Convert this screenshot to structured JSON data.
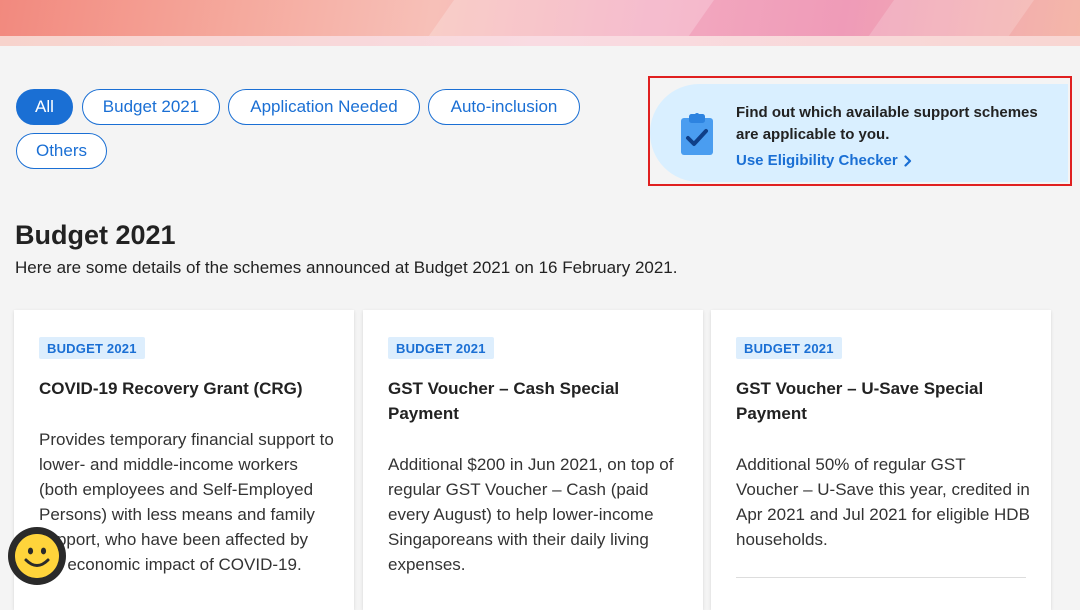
{
  "filters": [
    {
      "label": "All",
      "active": true
    },
    {
      "label": "Budget 2021",
      "active": false
    },
    {
      "label": "Application Needed",
      "active": false
    },
    {
      "label": "Auto-inclusion",
      "active": false
    },
    {
      "label": "Others",
      "active": false
    }
  ],
  "promo": {
    "text": "Find out which available support schemes are applicable to you.",
    "link_label": "Use Eligibility Checker",
    "icon": "clipboard-check-icon"
  },
  "section": {
    "title": "Budget 2021",
    "description": "Here are some details of the schemes announced at Budget 2021 on 16 February 2021."
  },
  "cards": [
    {
      "badge": "BUDGET 2021",
      "title": "COVID-19 Recovery Grant (CRG)",
      "body": "Provides temporary financial support to lower- and middle-income workers (both employees and Self-Employed Persons) with less means and family support, who have been affected by the economic impact of COVID-19."
    },
    {
      "badge": "BUDGET 2021",
      "title": "GST Voucher – Cash Special Payment",
      "body": "Additional $200 in Jun 2021, on top of regular GST Voucher – Cash (paid every August) to help lower-income Singaporeans with their daily living expenses."
    },
    {
      "badge": "BUDGET 2021",
      "title": "GST Voucher – U-Save Special Payment",
      "body": "Additional 50% of regular GST Voucher – U-Save this year, credited in Apr 2021 and Jul 2021 for eligible HDB households."
    }
  ],
  "chat_widget": {
    "icon": "smiley-face-icon"
  },
  "colors": {
    "accent": "#1a6fd4",
    "highlight_border": "#e02020",
    "promo_bg": "#d9efff",
    "badge_bg": "#ddeefd"
  }
}
